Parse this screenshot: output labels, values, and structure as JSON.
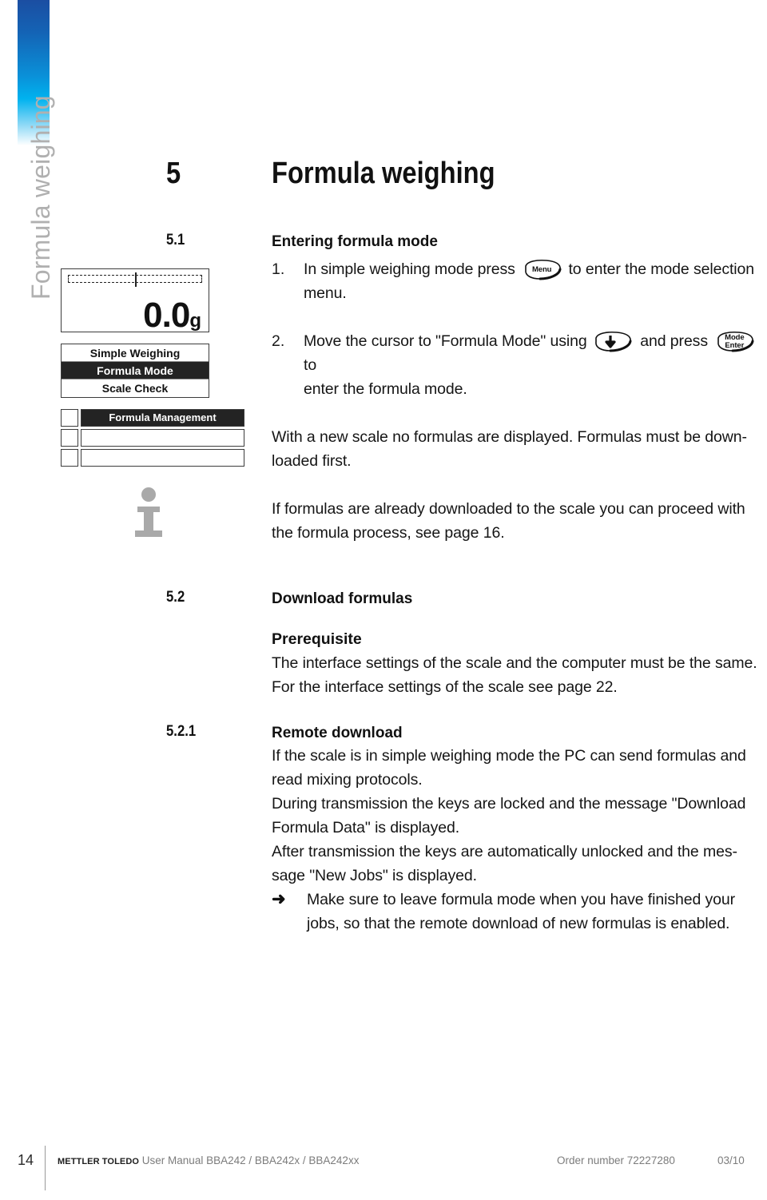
{
  "chapter_tab": {
    "label": "Formula weighing",
    "gradient_top": "#1b4ea2",
    "gradient_mid": "#00b2ef",
    "gradient_bottom": "#ffffff",
    "text_color": "#b0b0b0"
  },
  "heading": {
    "number": "5",
    "title": "Formula weighing"
  },
  "figures": {
    "lcd": {
      "value": "0.0",
      "unit": "g",
      "capacity_bar": "dashed-capacity-bar"
    },
    "mode_menu": {
      "items": [
        {
          "label": "Simple Weighing",
          "selected": false
        },
        {
          "label": "Formula Mode",
          "selected": true
        },
        {
          "label": "Scale Check",
          "selected": false
        }
      ]
    },
    "formula_list": {
      "rows": [
        {
          "label": "Formula Management",
          "filled": true
        },
        {
          "label": "",
          "filled": false
        },
        {
          "label": "",
          "filled": false
        }
      ]
    },
    "info_icon": "information-icon"
  },
  "sections": [
    {
      "id": "5.1",
      "number": "5.1",
      "title": "Entering formula mode",
      "steps": [
        {
          "number": "1.",
          "parts": [
            {
              "type": "text",
              "value": "In simple weighing mode press "
            },
            {
              "type": "key",
              "value": "Menu",
              "lines": [
                "Menu"
              ]
            },
            {
              "type": "text",
              "value": " to enter the mode selection menu."
            }
          ]
        },
        {
          "number": "2.",
          "parts": [
            {
              "type": "text",
              "value": "Move the cursor to \"Formula Mode\" using "
            },
            {
              "type": "key",
              "value": "down-arrow",
              "lines": [
                "↓"
              ]
            },
            {
              "type": "text",
              "value": " and press "
            },
            {
              "type": "key",
              "value": "Mode Enter",
              "lines": [
                "Mode",
                "Enter"
              ]
            },
            {
              "type": "text",
              "value": " to enter the formula mode."
            }
          ]
        }
      ],
      "paragraphs": [
        "With a new scale no formulas are displayed. Formulas must be downloaded first.",
        "If formulas are already downloaded to the scale you can proceed with the formula process, see page 16."
      ]
    },
    {
      "id": "5.2",
      "number": "5.2",
      "title": "Download formulas",
      "subheading": "Prerequisite",
      "paragraphs": [
        "The interface settings of the scale and the computer must be the same.",
        "For the interface settings of the scale see page 22."
      ]
    },
    {
      "id": "5.2.1",
      "number": "5.2.1",
      "title": "Remote download",
      "paragraphs": [
        "If the scale is in simple weighing mode the PC can send formulas and read mixing protocols.",
        "During transmission the keys are locked and the message \"Download Formula Data\" is displayed.",
        "After transmission the keys are automatically unlocked and the message \"New Jobs\" is displayed."
      ],
      "arrow_note": {
        "marker": "➜",
        "text": "Make sure to leave formula mode when you have finished your jobs, so that the remote download of new formulas is enabled."
      }
    }
  ],
  "footer": {
    "page_number": "14",
    "brand": "METTLER TOLEDO",
    "manual": "User Manual BBA242 / BBA242x / BBA242xx",
    "order_number": "Order number 72227280",
    "date_code": "03/10"
  },
  "text_fragments": {
    "s1_step1_a": "In simple weighing mode press",
    "s1_step1_b": "to enter the mode selection",
    "s1_step1_c": "menu.",
    "s1_step2_a": "Move the cursor to \"Formula Mode\" using",
    "s1_step2_b": "and press",
    "s1_step2_c": "to",
    "s1_step2_d": "enter the formula mode.",
    "s1_p1": "With a new scale no formulas are displayed. Formulas must be down-",
    "s1_p1b": "loaded first.",
    "s1_p2": "If formulas are already downloaded to the scale you can proceed with",
    "s1_p2b": "the formula process, see page 16.",
    "s2_p1": "The interface settings of the scale and the computer must be the same.",
    "s2_p2": "For the interface settings of the scale see page 22.",
    "s21_p1": "If the scale is in simple weighing mode the PC can send formulas and",
    "s21_p1b": "read mixing protocols.",
    "s21_p2": "During transmission the keys are locked and the message \"Download",
    "s21_p2b": "Formula Data\" is displayed.",
    "s21_p3": "After transmission the keys are automatically unlocked and the mes-",
    "s21_p3b": "sage \"New Jobs\" is displayed.",
    "s21_arrow_a": "Make sure to leave formula mode when you have finished your",
    "s21_arrow_b": "jobs, so that the remote download of new formulas is enabled.",
    "key_menu": "Menu",
    "key_mode": "Mode",
    "key_enter": "Enter"
  }
}
